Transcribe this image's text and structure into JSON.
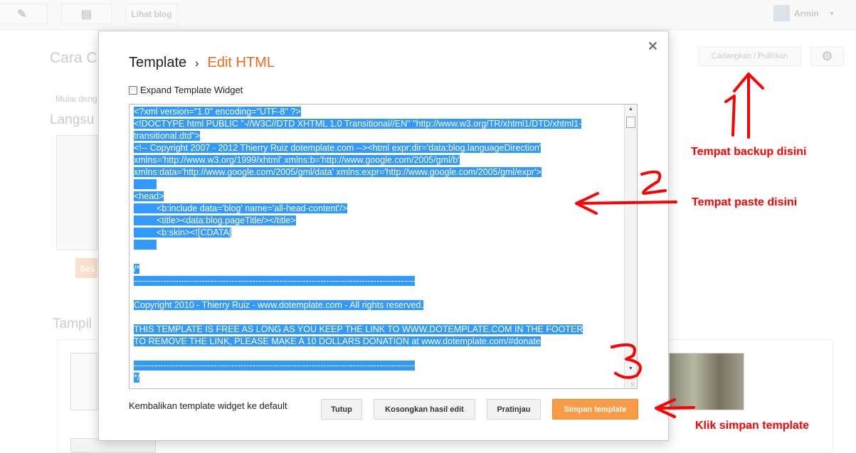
{
  "topbar": {
    "view_blog": "Lihat blog",
    "user": "Armin"
  },
  "background": {
    "title_fragment": "Cara C",
    "start_fragment": "Mulai deng",
    "live_fragment": "Langsu",
    "customize_button_fragment": "Ses",
    "templates_fragment": "Tampil",
    "backup_button": "Cadangkan / Pulihkan"
  },
  "modal": {
    "breadcrumb_parent": "Template",
    "breadcrumb_separator": "›",
    "breadcrumb_current": "Edit HTML",
    "expand_widget_label": "Expand Template Widget",
    "expand_widget_checked": false,
    "code_lines": [
      "<?xml version=\"1.0\" encoding=\"UTF-8\" ?>",
      "<!DOCTYPE html PUBLIC \"-//W3C//DTD XHTML 1.0 Transitional//EN\" \"http://www.w3.org/TR/xhtml1/DTD/xhtml1-",
      "transitional.dtd\">",
      "<!-- Copyright 2007 - 2012 Thierry Ruiz dotemplate.com --><html expr:dir='data:blog.languageDirection'",
      "xmlns='http://www.w3.org/1999/xhtml' xmlns:b='http://www.google.com/2005/gml/b'",
      "xmlns:data='http://www.google.com/2005/gml/data' xmlns:expr='http://www.google.com/2005/gml/expr'>",
      "\t",
      "<head>",
      "\t<b:include data='blog' name='all-head-content'/>",
      "\t<title><data:blog.pageTitle/></title>",
      "\t<b:skin><![CDATA[",
      "\t",
      "",
      "/*",
      "-----------------------------------------------------------------------------------------------",
      "",
      "Copyright 2010 - Thierry Ruiz - www.dotemplate.com - All rights reserved.",
      "",
      "THIS TEMPLATE IS FREE AS LONG AS YOU KEEP THE LINK TO WWW.DOTEMPLATE.COM IN THE FOOTER",
      "TO REMOVE THE LINK, PLEASE MAKE A 10 DOLLARS DONATION at www.dotemplate.com/#donate",
      "",
      "-----------------------------------------------------------------------------------------------",
      "*/"
    ],
    "revert_widgets_link": "Kembalikan template widget ke default",
    "buttons": {
      "close": "Tutup",
      "clear": "Kosongkan hasil edit",
      "preview": "Pratinjau",
      "save": "Simpan template"
    },
    "accent": "#f26b1d",
    "save_color": "#f99c45",
    "selection_color": "#3399ff"
  },
  "annotations": {
    "backup": "Tempat backup disini",
    "paste": "Tempat paste disini",
    "save": "Klik simpan template",
    "color": "#ff0000",
    "numbers": [
      "1",
      "2",
      "3"
    ]
  }
}
